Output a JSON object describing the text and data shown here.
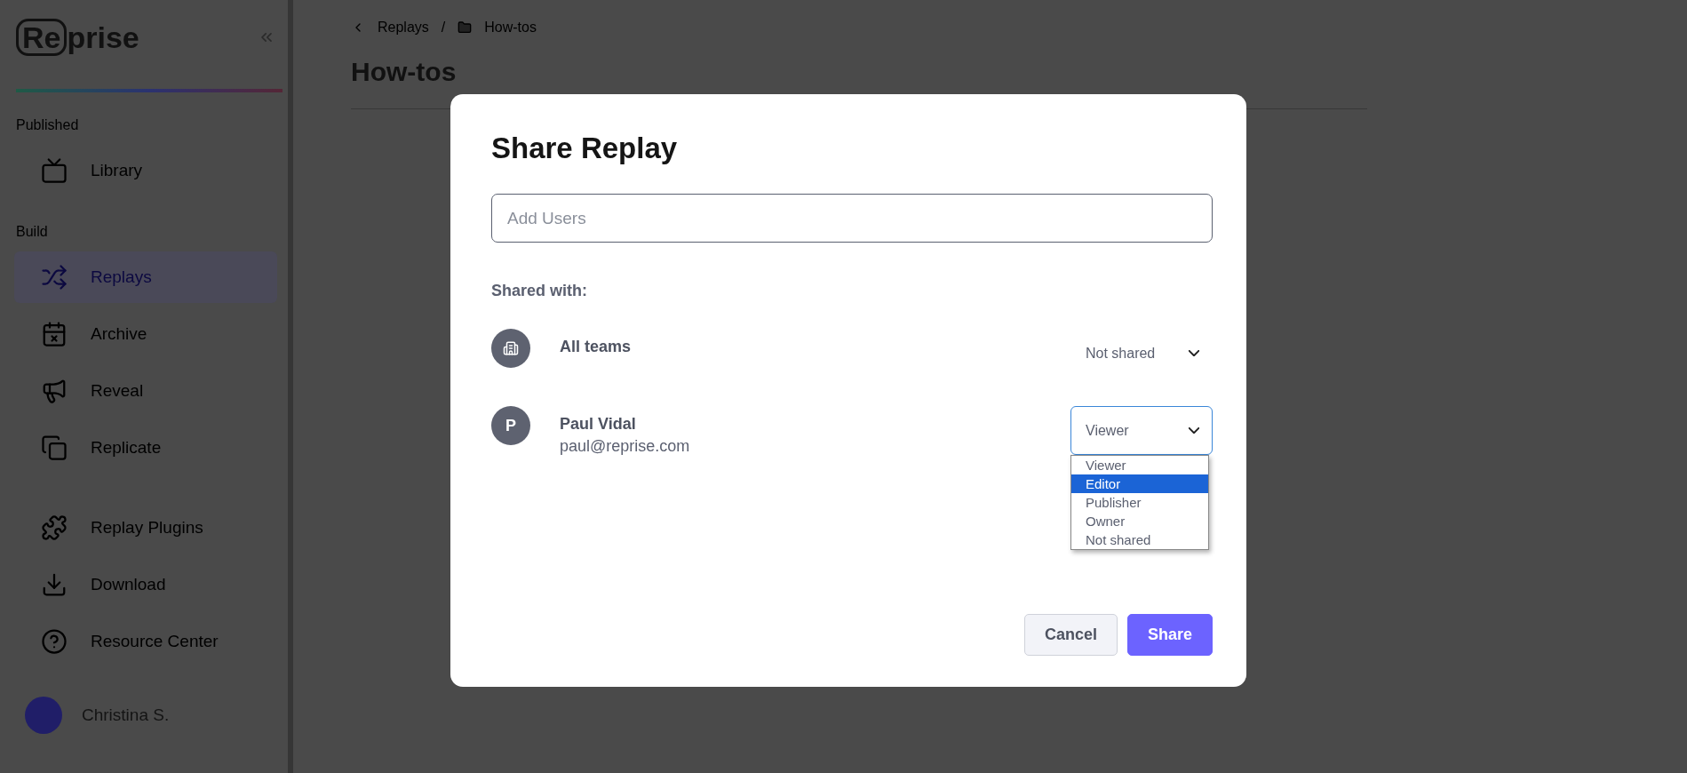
{
  "sidebar": {
    "logo": {
      "boxed": "Re",
      "rest": "prise"
    },
    "sections": [
      {
        "title": "Published",
        "items": [
          {
            "label": "Library",
            "selected": false
          }
        ]
      },
      {
        "title": "Build",
        "items": [
          {
            "label": "Replays",
            "selected": true
          },
          {
            "label": "Archive",
            "selected": false
          },
          {
            "label": "Reveal",
            "selected": false
          },
          {
            "label": "Replicate",
            "selected": false
          }
        ]
      }
    ],
    "footer_items": [
      {
        "label": "Replay Plugins"
      },
      {
        "label": "Download"
      },
      {
        "label": "Resource Center"
      }
    ],
    "user": {
      "name": "Christina S."
    }
  },
  "main": {
    "breadcrumb": [
      "Replays",
      "How-tos"
    ],
    "separator": "/",
    "title": "How-tos"
  },
  "dialog": {
    "title": "Share Replay",
    "add_users": {
      "placeholder": "Add Users"
    },
    "shared_label": "Shared with:",
    "entries": [
      {
        "kind": "team",
        "name": "All teams",
        "role": "Not shared",
        "open": false
      },
      {
        "kind": "user",
        "initial": "P",
        "name": "Paul Vidal",
        "email": "paul@reprise.com",
        "role": "Viewer",
        "open": true,
        "options": [
          {
            "label": "Viewer",
            "selected": false
          },
          {
            "label": "Editor",
            "selected": true
          },
          {
            "label": "Publisher",
            "selected": false
          },
          {
            "label": "Owner",
            "selected": false
          },
          {
            "label": "Not shared",
            "selected": false
          }
        ]
      }
    ],
    "buttons": {
      "cancel": "Cancel",
      "share": "Share"
    }
  }
}
